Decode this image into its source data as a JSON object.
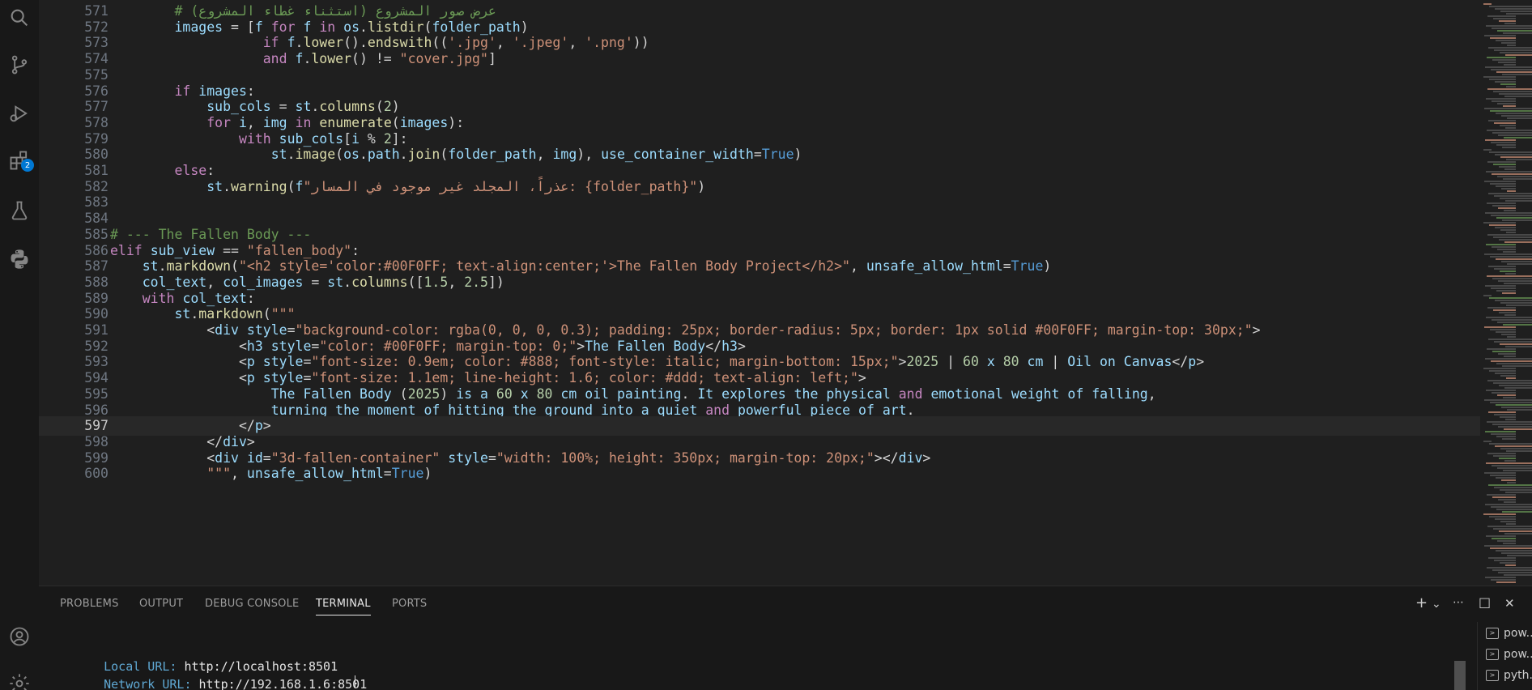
{
  "activity_bar": {
    "icons": [
      "search-icon",
      "source-control-icon",
      "run-debug-icon",
      "extensions-icon",
      "testing-icon",
      "python-icon",
      "account-icon",
      "settings-gear-icon"
    ],
    "extensions_badge": "2"
  },
  "editor": {
    "lines": [
      {
        "n": "571",
        "text": "        # (عرض صور المشروع (استثناء غطاء المشروع"
      },
      {
        "n": "572",
        "text": "        images = [f for f in os.listdir(folder_path)"
      },
      {
        "n": "573",
        "text": "                   if f.lower().endswith(('.jpg', '.jpeg', '.png'))"
      },
      {
        "n": "574",
        "text": "                   and f.lower() != \"cover.jpg\"]"
      },
      {
        "n": "575",
        "text": ""
      },
      {
        "n": "576",
        "text": "        if images:"
      },
      {
        "n": "577",
        "text": "            sub_cols = st.columns(2)"
      },
      {
        "n": "578",
        "text": "            for i, img in enumerate(images):"
      },
      {
        "n": "579",
        "text": "                with sub_cols[i % 2]:"
      },
      {
        "n": "580",
        "text": "                    st.image(os.path.join(folder_path, img), use_container_width=True)"
      },
      {
        "n": "581",
        "text": "        else:"
      },
      {
        "n": "582",
        "text": "            st.warning(f\"عذراً، المجلد غير موجود في المسار: {folder_path}\")"
      },
      {
        "n": "583",
        "text": ""
      },
      {
        "n": "584",
        "text": ""
      },
      {
        "n": "585",
        "text": "# --- The Fallen Body ---"
      },
      {
        "n": "586",
        "text": "elif sub_view == \"fallen_body\":"
      },
      {
        "n": "587",
        "text": "    st.markdown(\"<h2 style='color:#00F0FF; text-align:center;'>The Fallen Body Project</h2>\", unsafe_allow_html=True)"
      },
      {
        "n": "588",
        "text": "    col_text, col_images = st.columns([1.5, 2.5])"
      },
      {
        "n": "589",
        "text": "    with col_text:"
      },
      {
        "n": "590",
        "text": "        st.markdown(\"\"\""
      },
      {
        "n": "591",
        "text": "            <div style=\"background-color: rgba(0, 0, 0, 0.3); padding: 25px; border-radius: 5px; border: 1px solid #00F0FF; margin-top: 30px;\">"
      },
      {
        "n": "592",
        "text": "                <h3 style=\"color: #00F0FF; margin-top: 0;\">The Fallen Body</h3>"
      },
      {
        "n": "593",
        "text": "                <p style=\"font-size: 0.9em; color: #888; font-style: italic; margin-bottom: 15px;\">2025 | 60 x 80 cm | Oil on Canvas</p>"
      },
      {
        "n": "594",
        "text": "                <p style=\"font-size: 1.1em; line-height: 1.6; color: #ddd; text-align: left;\">"
      },
      {
        "n": "595",
        "text": "                    The Fallen Body (2025) is a 60 x 80 cm oil painting. It explores the physical and emotional weight of falling,"
      },
      {
        "n": "596",
        "text": "                    turning the moment of hitting the ground into a quiet and powerful piece of art."
      },
      {
        "n": "597",
        "text": "                </p>"
      },
      {
        "n": "598",
        "text": "            </div>"
      },
      {
        "n": "599",
        "text": "            <div id=\"3d-fallen-container\" style=\"width: 100%; height: 350px; margin-top: 20px;\"></div>"
      },
      {
        "n": "600",
        "text": "            \"\"\", unsafe_allow_html=True)"
      }
    ],
    "current_line": "597"
  },
  "panel": {
    "tabs": [
      "PROBLEMS",
      "OUTPUT",
      "DEBUG CONSOLE",
      "TERMINAL",
      "PORTS"
    ],
    "active_tab": "TERMINAL",
    "actions": {
      "new": "+",
      "dropdown": "⌄",
      "split": "⋯",
      "maximize": "□",
      "close": "✕"
    },
    "terminal": {
      "local_label": "Local URL:",
      "local_url": "http://localhost:8501",
      "network_label": "Network URL:",
      "network_url": "http://192.168.1.6:8501"
    },
    "terminals": [
      "pow...",
      "pow...",
      "pyth..."
    ]
  }
}
